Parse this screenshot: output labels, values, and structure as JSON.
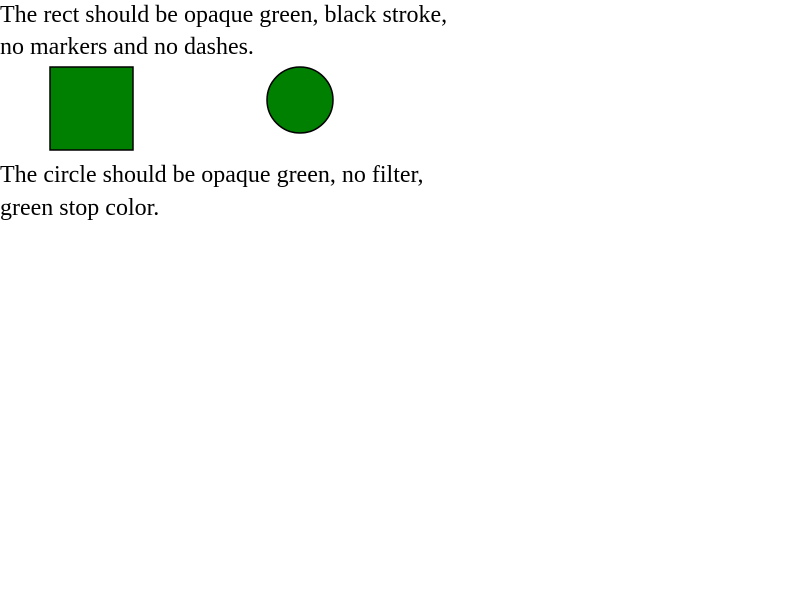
{
  "text": {
    "line_1": "The rect should be opaque green, black stroke,",
    "line_2": "no markers and no dashes.",
    "line_3": "The circle should be opaque green, no filter,",
    "line_4": "green stop color."
  },
  "shapes": {
    "fill_color": "#008000",
    "stroke_color": "#000000"
  }
}
